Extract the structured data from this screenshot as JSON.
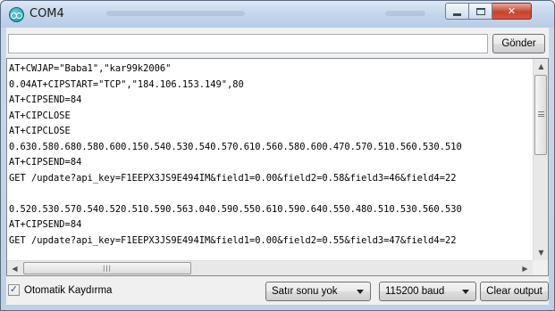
{
  "window": {
    "title": "COM4",
    "controls": {
      "minimize_icon": "minimize-icon",
      "maximize_icon": "maximize-icon",
      "close_icon": "close-icon",
      "close_glyph": "✕"
    }
  },
  "send_bar": {
    "input_value": "",
    "button_label": "Gönder"
  },
  "serial_output": {
    "lines": [
      "AT+CWJAP=\"Baba1\",\"kar99k2006\"",
      "0.04AT+CIPSTART=\"TCP\",\"184.106.153.149\",80",
      "AT+CIPSEND=84",
      "AT+CIPCLOSE",
      "AT+CIPCLOSE",
      "0.630.580.680.580.600.150.540.530.540.570.610.560.580.600.470.570.510.560.530.510",
      "AT+CIPSEND=84",
      "GET /update?api_key=F1EEPX3JS9E494IM&field1=0.00&field2=0.58&field3=46&field4=22",
      "",
      "0.520.530.570.540.520.510.590.563.040.590.550.610.590.640.550.480.510.530.560.530",
      "AT+CIPSEND=84",
      "GET /update?api_key=F1EEPX3JS9E494IM&field1=0.00&field2=0.55&field3=47&field4=22"
    ],
    "vscroll": {
      "up_arrow": "▲",
      "down_arrow": "▼",
      "grip_icon": "grip-icon"
    },
    "hscroll": {
      "left_arrow": "◀",
      "right_arrow": "▶",
      "thumb_grip": "|||"
    }
  },
  "bottom_bar": {
    "autoscroll_label": "Otomatik Kaydırma",
    "autoscroll_checked": true,
    "check_glyph": "✓",
    "line_ending_selected": "Satır sonu yok",
    "baud_rate_selected": "115200 baud",
    "clear_label": "Clear output"
  }
}
